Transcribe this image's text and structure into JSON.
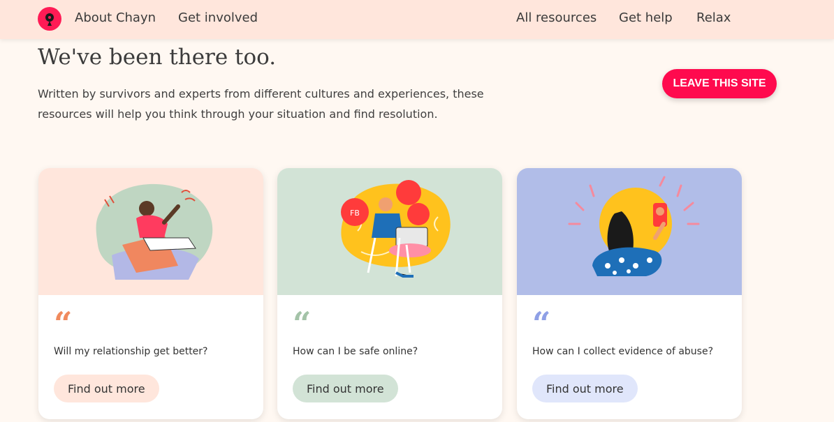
{
  "nav": {
    "logo_alt": "Chayn logo",
    "left": [
      "About Chayn",
      "Get involved"
    ],
    "right": [
      "All resources",
      "Get help",
      "Relax"
    ]
  },
  "hero": {
    "title": "We've been there too.",
    "subtitle": "Written by survivors and experts from different cultures and experiences, these resources will help you think through your situation and find resolution.",
    "leave_button": "LEAVE THIS SITE"
  },
  "cards": [
    {
      "question": "Will my relationship get better?",
      "button": "Find out more",
      "quote": "“",
      "illustration_bg": "#ffe6dc",
      "quote_color": "#f08a5d",
      "button_bg": "#ffe6dc"
    },
    {
      "question": "How can I be safe online?",
      "button": "Find out more",
      "quote": "“",
      "illustration_bg": "#d2e3d6",
      "quote_color": "#a4c3a8",
      "button_bg": "#d2e3d6",
      "bubble_labels": [
        "FB"
      ]
    },
    {
      "question": "How can I collect evidence of abuse?",
      "button": "Find out more",
      "quote": "“",
      "illustration_bg": "#b1bde8",
      "quote_color": "#8fa0e6",
      "button_bg": "#e0e6fb"
    }
  ],
  "colors": {
    "header_bg": "#ffe6dc",
    "page_bg": "#fff8f2",
    "accent": "#ff0a4e"
  }
}
